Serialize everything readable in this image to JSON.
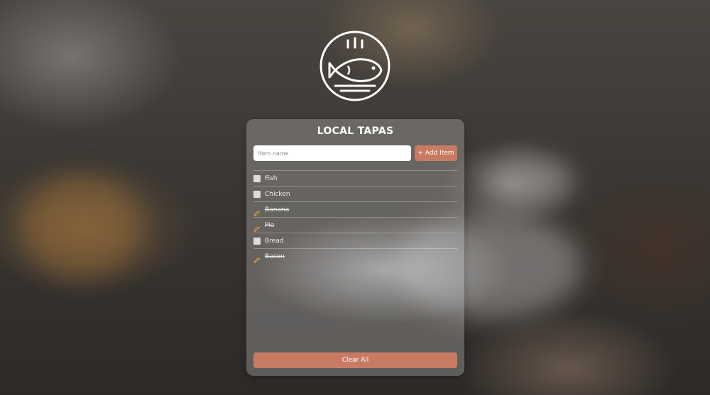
{
  "card": {
    "title": "LOCAL TAPAS"
  },
  "form": {
    "input_value": "",
    "input_placeholder": "Item name",
    "add_label": "+ Add Item"
  },
  "items": [
    {
      "label": "Fish",
      "done": false
    },
    {
      "label": "Chicken",
      "done": false
    },
    {
      "label": "Banana",
      "done": true
    },
    {
      "label": "Pie",
      "done": true
    },
    {
      "label": "Bread",
      "done": false
    },
    {
      "label": "Bacon",
      "done": true
    }
  ],
  "footer": {
    "clear_label": "Clear All"
  },
  "icons": {
    "logo": "fish-plate-icon",
    "done": "taco-icon"
  },
  "colors": {
    "accent": "#c97a63",
    "card_bg": "rgba(200,200,200,0.32)",
    "text": "#ffffff"
  }
}
